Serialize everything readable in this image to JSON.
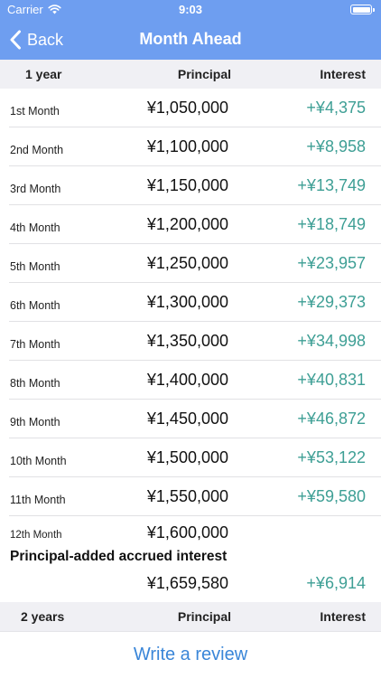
{
  "status": {
    "carrier": "Carrier",
    "time": "9:03"
  },
  "nav": {
    "back_label": "Back",
    "title": "Month Ahead"
  },
  "section1": {
    "label": "1 year",
    "col_principal": "Principal",
    "col_interest": "Interest"
  },
  "rows": [
    {
      "month": "1st Month",
      "principal": "¥1,050,000",
      "interest": "+¥4,375"
    },
    {
      "month": "2nd Month",
      "principal": "¥1,100,000",
      "interest": "+¥8,958"
    },
    {
      "month": "3rd Month",
      "principal": "¥1,150,000",
      "interest": "+¥13,749"
    },
    {
      "month": "4th Month",
      "principal": "¥1,200,000",
      "interest": "+¥18,749"
    },
    {
      "month": "5th Month",
      "principal": "¥1,250,000",
      "interest": "+¥23,957"
    },
    {
      "month": "6th Month",
      "principal": "¥1,300,000",
      "interest": "+¥29,373"
    },
    {
      "month": "7th Month",
      "principal": "¥1,350,000",
      "interest": "+¥34,998"
    },
    {
      "month": "8th Month",
      "principal": "¥1,400,000",
      "interest": "+¥40,831"
    },
    {
      "month": "9th Month",
      "principal": "¥1,450,000",
      "interest": "+¥46,872"
    },
    {
      "month": "10th Month",
      "principal": "¥1,500,000",
      "interest": "+¥53,122"
    },
    {
      "month": "11th Month",
      "principal": "¥1,550,000",
      "interest": "+¥59,580"
    }
  ],
  "last_row": {
    "month": "12th Month",
    "principal": "¥1,600,000"
  },
  "accrued": {
    "title": "Principal-added accrued interest",
    "principal": "¥1,659,580",
    "interest": "+¥6,914"
  },
  "section2": {
    "label": "2 years",
    "col_principal": "Principal",
    "col_interest": "Interest"
  },
  "footer": {
    "review_label": "Write a review"
  },
  "colors": {
    "nav_bar": "#6e9ef0",
    "interest_text": "#3e9f95",
    "link": "#3a86d8",
    "section_bg": "#f0f0f4"
  }
}
